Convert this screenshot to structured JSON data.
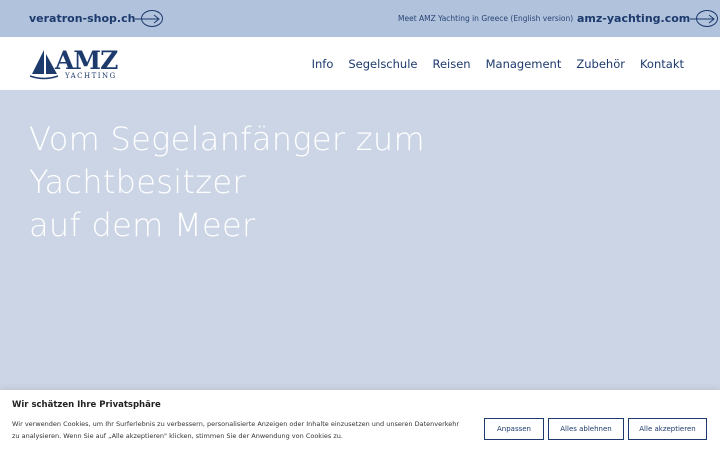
{
  "topbar": {
    "left_link": "veratron-shop.ch",
    "middle_link": "Meet AMZ Yachting in Greece (English version)",
    "right_link": "amz-yachting.com"
  },
  "logo": {
    "main": "AMZ",
    "sub": "YACHTING"
  },
  "nav": {
    "items": [
      "Info",
      "Segelschule",
      "Reisen",
      "Management",
      "Zubehör",
      "Kontakt"
    ]
  },
  "hero": {
    "line1": "Vom Segelanfänger zum",
    "line2": "Yachtbesitzer",
    "line3": "auf dem Meer"
  },
  "cookie": {
    "title": "Wir schätzen Ihre Privatsphäre",
    "text": "Wir verwenden Cookies, um Ihr Surferlebnis zu verbessern, personalisierte Anzeigen oder Inhalte einzusetzen und unseren Datenverkehr zu analysieren. Wenn Sie auf „Alle akzeptieren\" klicken, stimmen Sie der Anwendung von Cookies zu.",
    "btn_customize": "Anpassen",
    "btn_reject": "Alles ablehnen",
    "btn_accept": "Alle akzeptieren"
  },
  "colors": {
    "primary": "#1d3a6d",
    "topbar_bg": "#b0c2dc",
    "hero_bg": "#ccd5e5"
  }
}
